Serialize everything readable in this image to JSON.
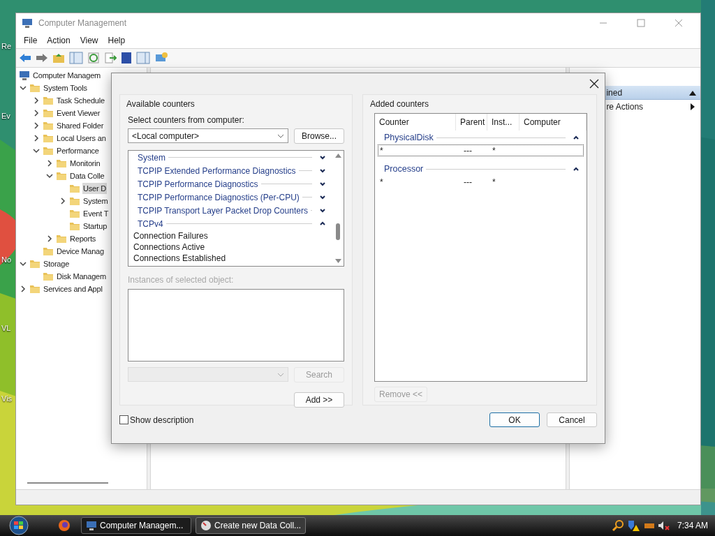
{
  "desktop": {
    "icon_labels": [
      "Re",
      "Ev",
      "No",
      "VL",
      "Vis"
    ]
  },
  "window": {
    "title": "Computer Management",
    "menu": [
      "File",
      "Action",
      "View",
      "Help"
    ],
    "tree": [
      {
        "label": "Computer Managem",
        "kind": "root",
        "selected": false,
        "children": [
          {
            "label": "System Tools",
            "kind": "branch",
            "expanded": true,
            "selected": false,
            "children": [
              {
                "label": "Task Schedule",
                "kind": "branch",
                "expanded": false,
                "selected": false
              },
              {
                "label": "Event Viewer",
                "kind": "branch",
                "expanded": false,
                "selected": false
              },
              {
                "label": "Shared Folder",
                "kind": "branch",
                "expanded": false,
                "selected": false
              },
              {
                "label": "Local Users an",
                "kind": "branch",
                "expanded": false,
                "selected": false
              },
              {
                "label": "Performance",
                "kind": "branch",
                "expanded": true,
                "selected": false,
                "children": [
                  {
                    "label": "Monitorin",
                    "kind": "branch",
                    "expanded": false,
                    "selected": false
                  },
                  {
                    "label": "Data Colle",
                    "kind": "branch",
                    "expanded": true,
                    "selected": false,
                    "children": [
                      {
                        "label": "User D",
                        "kind": "leaf",
                        "selected": true
                      },
                      {
                        "label": "System",
                        "kind": "branch",
                        "expanded": false,
                        "selected": false
                      },
                      {
                        "label": "Event T",
                        "kind": "leaf",
                        "selected": false
                      },
                      {
                        "label": "Startup",
                        "kind": "leaf",
                        "selected": false
                      }
                    ]
                  },
                  {
                    "label": "Reports",
                    "kind": "branch",
                    "expanded": false,
                    "selected": false
                  }
                ]
              },
              {
                "label": "Device Manag",
                "kind": "leaf",
                "selected": false
              }
            ]
          },
          {
            "label": "Storage",
            "kind": "branch",
            "expanded": true,
            "selected": false,
            "children": [
              {
                "label": "Disk Managem",
                "kind": "leaf",
                "selected": false
              }
            ]
          },
          {
            "label": "Services and Appl",
            "kind": "branch",
            "expanded": false,
            "selected": false
          }
        ]
      }
    ],
    "actions": [
      {
        "label": "ined",
        "kind": "header"
      },
      {
        "label": "re Actions",
        "kind": "item"
      }
    ]
  },
  "dialog": {
    "available": {
      "title": "Available counters",
      "computer_label": "Select counters from computer:",
      "computer": "<Local computer>",
      "browse": "Browse...",
      "items": [
        {
          "label": "System",
          "kind": "object",
          "expanded": false
        },
        {
          "label": "TCPIP Extended Performance Diagnostics",
          "kind": "object",
          "expanded": false
        },
        {
          "label": "TCPIP Performance Diagnostics",
          "kind": "object",
          "expanded": false
        },
        {
          "label": "TCPIP Performance Diagnostics (Per-CPU)",
          "kind": "object",
          "expanded": false
        },
        {
          "label": "TCPIP Transport Layer Packet Drop Counters",
          "kind": "object",
          "expanded": false
        },
        {
          "label": "TCPv4",
          "kind": "object",
          "expanded": true
        },
        {
          "label": "Connection Failures",
          "kind": "counter"
        },
        {
          "label": "Connections Active",
          "kind": "counter"
        },
        {
          "label": "Connections Established",
          "kind": "counter"
        }
      ],
      "instances_label": "Instances of selected object:",
      "search": {
        "label": "Search",
        "disabled": true
      },
      "add": {
        "label": "Add >>",
        "disabled": false
      }
    },
    "added": {
      "title": "Added counters",
      "columns": [
        "Counter",
        "Parent",
        "Inst...",
        "Computer"
      ],
      "groups": [
        {
          "name": "PhysicalDisk",
          "expanded": true,
          "rows": [
            {
              "counter": "*",
              "parent": "---",
              "instance": "*",
              "selected": true
            }
          ]
        },
        {
          "name": "Processor",
          "expanded": true,
          "rows": [
            {
              "counter": "*",
              "parent": "---",
              "instance": "*",
              "selected": false
            }
          ]
        }
      ],
      "remove": {
        "label": "Remove <<",
        "disabled": true
      }
    },
    "show_description": {
      "label": "Show description",
      "checked": false
    },
    "ok": {
      "label": "OK",
      "default": true
    },
    "cancel": {
      "label": "Cancel",
      "default": false
    }
  },
  "taskbar": {
    "tasks": [
      {
        "label": "Computer Managem...",
        "selected": true
      },
      {
        "label": "Create new Data Coll...",
        "selected": false
      }
    ],
    "clock": "7:34 AM"
  }
}
